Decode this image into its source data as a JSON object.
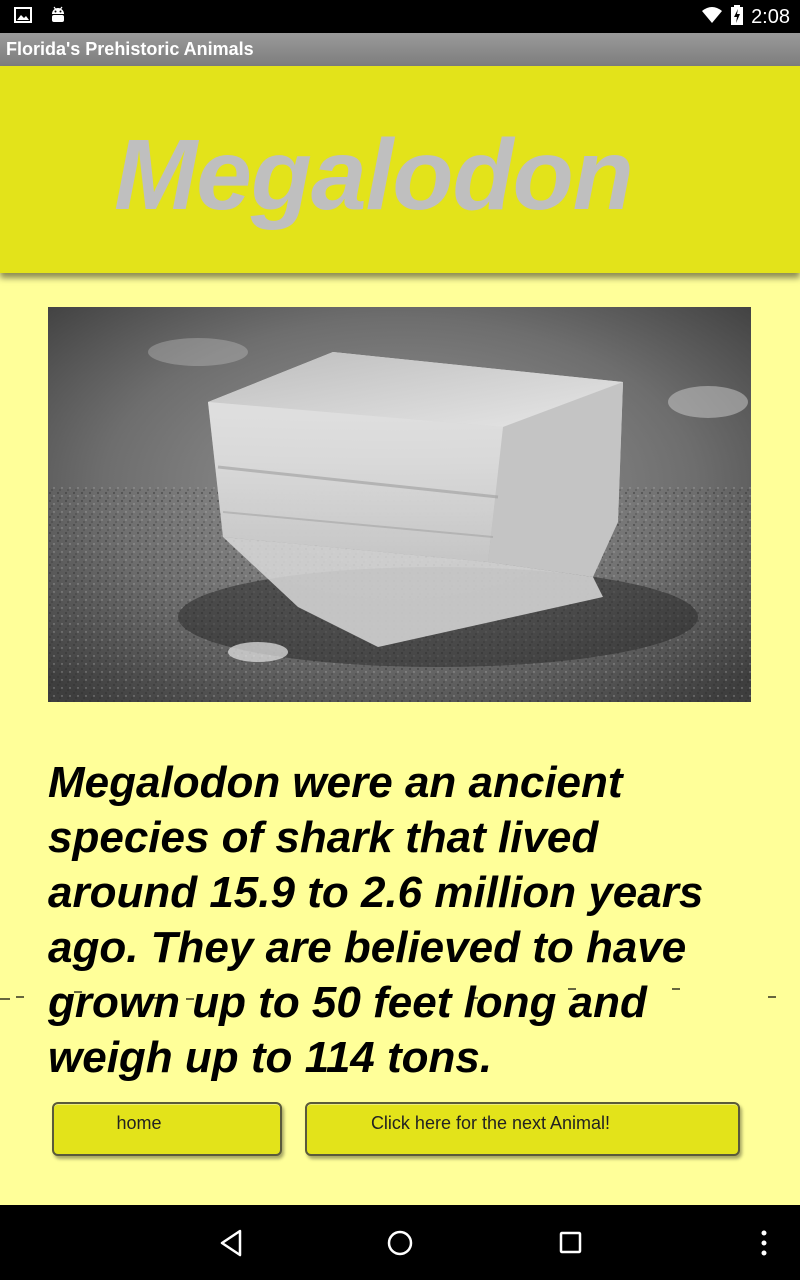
{
  "status_bar": {
    "time": "2:08",
    "icons": [
      "gallery-icon",
      "android-icon",
      "wifi-icon",
      "battery-charging-icon"
    ]
  },
  "app_bar": {
    "title": "Florida's Prehistoric Animals"
  },
  "header": {
    "title": "Megalodon",
    "background_color": "#e3e31a",
    "title_color": "#bfbfbf"
  },
  "photo": {
    "subject": "fossil-tooth-photo-grayscale"
  },
  "content": {
    "description": "Megalodon were an ancient species of shark that lived around 15.9 to 2.6 million years ago. They are believed to have grown up to 50 feet long and weigh up to 114 tons."
  },
  "buttons": {
    "home_label": "home",
    "next_label": "Click here for the next Animal!"
  },
  "nav_bar": {
    "icons": [
      "back-icon",
      "home-circle-icon",
      "recents-icon",
      "overflow-menu-icon"
    ]
  },
  "colors": {
    "page_background": "#ffff99",
    "accent": "#e3e31a"
  }
}
